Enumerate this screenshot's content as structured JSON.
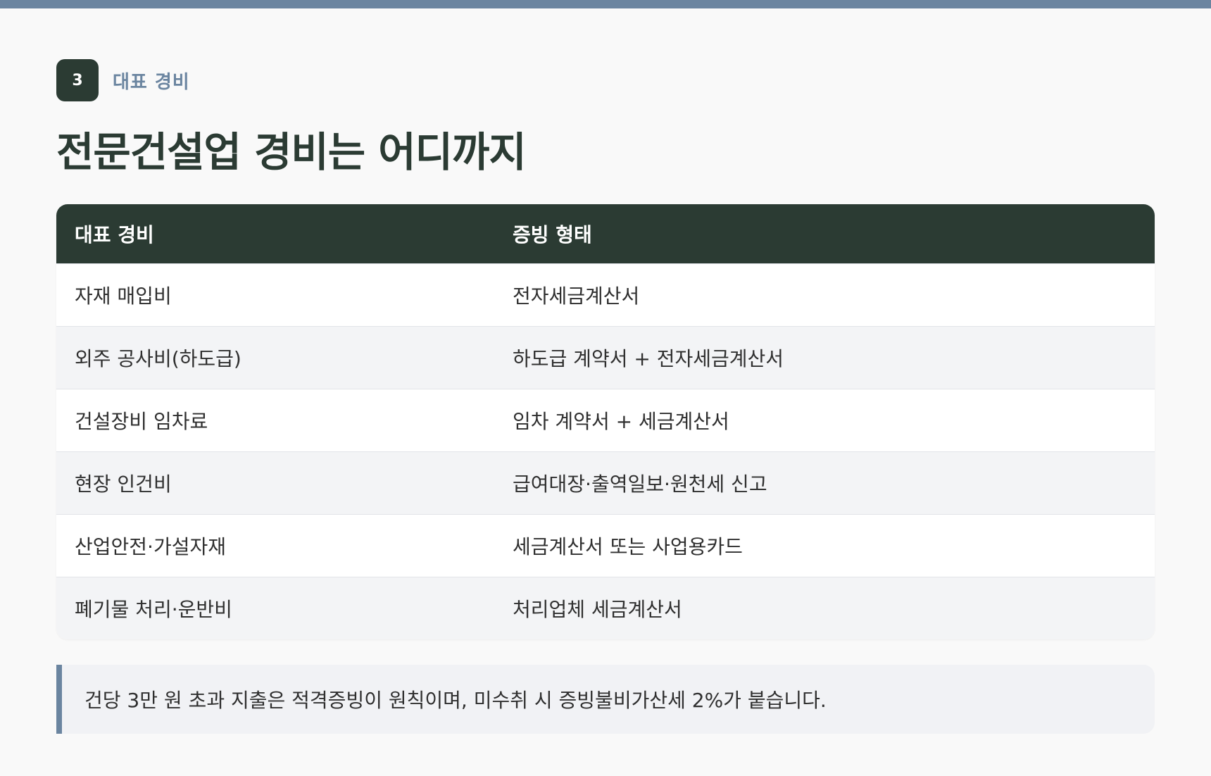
{
  "section": {
    "number": "3",
    "label": "대표 경비"
  },
  "page_title": "전문건설업 경비는 어디까지",
  "table": {
    "headers": [
      "대표 경비",
      "증빙 형태"
    ],
    "rows": [
      [
        "자재 매입비",
        "전자세금계산서"
      ],
      [
        "외주 공사비(하도급)",
        "하도급 계약서 + 전자세금계산서"
      ],
      [
        "건설장비 임차료",
        "임차 계약서 + 세금계산서"
      ],
      [
        "현장 인건비",
        "급여대장·출역일보·원천세 신고"
      ],
      [
        "산업안전·가설자재",
        "세금계산서 또는 사업용카드"
      ],
      [
        "폐기물 처리·운반비",
        "처리업체 세금계산서"
      ]
    ]
  },
  "note": "건당 3만 원 초과 지출은 적격증빙이 원칙이며, 미수취 시 증빙불비가산세 2%가 붙습니다.",
  "colors": {
    "accent": "#6b85a0",
    "dark_green": "#2b3b33",
    "background": "#f9f9f9"
  }
}
